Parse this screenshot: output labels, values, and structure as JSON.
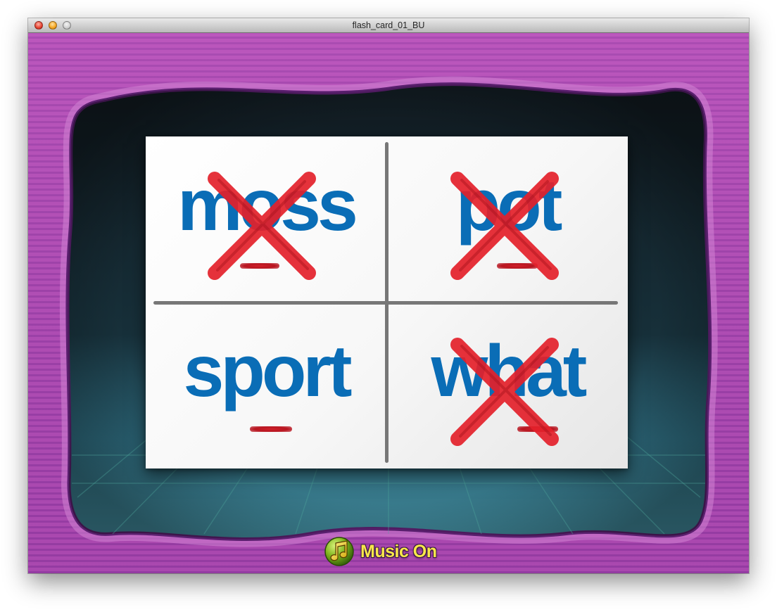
{
  "window": {
    "title": "flash_card_01_BU"
  },
  "flash_card": {
    "words": [
      {
        "text": "moss",
        "crossed_out": true
      },
      {
        "text": "pot",
        "crossed_out": true
      },
      {
        "text": "sport",
        "crossed_out": false
      },
      {
        "text": "what",
        "crossed_out": true
      }
    ]
  },
  "music_toggle": {
    "label": "Music On",
    "icon": "music-note-icon"
  },
  "colors": {
    "word_text": "#0a6db6",
    "cross_mark": "#e4212b",
    "frame_purple": "#b24fb5",
    "stage_dark": "#121d24",
    "music_label": "#f8e84a"
  }
}
